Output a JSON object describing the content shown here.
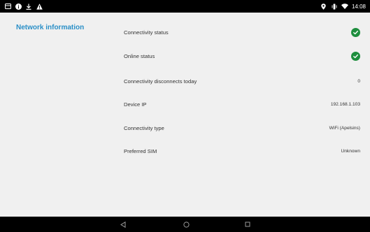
{
  "status_bar": {
    "time": "14:08",
    "left_icons": [
      "notification-icon",
      "info-icon",
      "download-icon",
      "warning-icon"
    ],
    "right_icons": [
      "location-icon",
      "vibrate-icon",
      "wifi-icon"
    ]
  },
  "sidebar": {
    "title": "Network information"
  },
  "network_info": {
    "rows": [
      {
        "label": "Connectivity status",
        "value": "",
        "status": "ok"
      },
      {
        "label": "Online status",
        "value": "",
        "status": "ok"
      },
      {
        "label": "Connectivity disconnects today",
        "value": "0"
      },
      {
        "label": "Device IP",
        "value": "192.168.1.103"
      },
      {
        "label": "Connectivity type",
        "value": "WiFi (Apelsins)"
      },
      {
        "label": "Preferred SIM",
        "value": "Unknown"
      }
    ]
  },
  "nav_bar": {
    "buttons": [
      "back-icon",
      "home-icon",
      "recents-icon"
    ]
  },
  "colors": {
    "accent": "#2a8fc7",
    "check_green": "#1e8e3e",
    "background": "#f0f0f0",
    "bars": "#000000"
  }
}
